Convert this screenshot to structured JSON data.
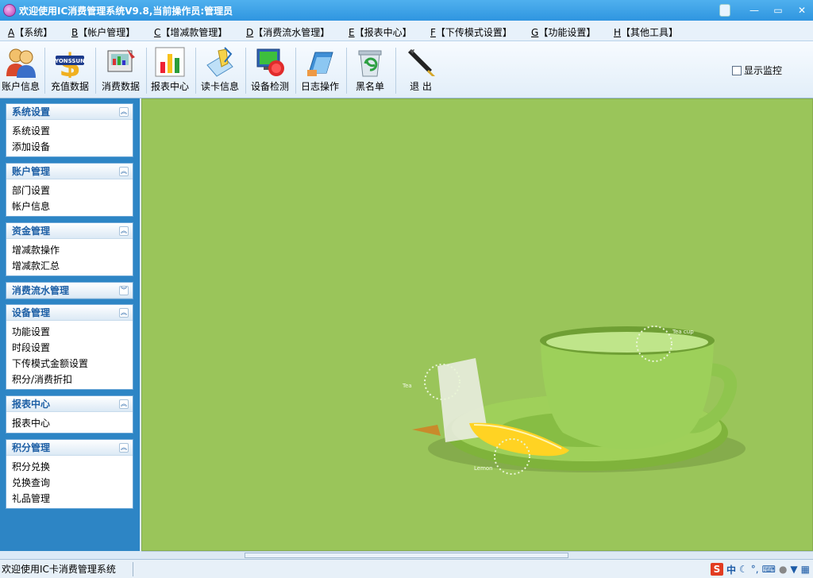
{
  "window": {
    "title": "欢迎使用IC消费管理系统V9.8,当前操作员:管理员",
    "controls": {
      "minimize": "—",
      "maximize": "▭",
      "close": "✕"
    }
  },
  "menu": [
    {
      "key": "A",
      "label": "【系统】"
    },
    {
      "key": "B",
      "label": "【帐户管理】"
    },
    {
      "key": "C",
      "label": "【增减款管理】"
    },
    {
      "key": "D",
      "label": "【消费流水管理】"
    },
    {
      "key": "E",
      "label": "【报表中心】"
    },
    {
      "key": "F",
      "label": "【下传模式设置】"
    },
    {
      "key": "G",
      "label": "【功能设置】"
    },
    {
      "key": "H",
      "label": "【其他工具】"
    }
  ],
  "toolbar": {
    "items": [
      {
        "label": "账户信息",
        "icon": "users-icon"
      },
      {
        "label": "充值数据",
        "icon": "recharge-icon"
      },
      {
        "label": "消费数据",
        "icon": "consumption-icon"
      },
      {
        "label": "报表中心",
        "icon": "report-chart-icon"
      },
      {
        "label": "读卡信息",
        "icon": "card-read-icon"
      },
      {
        "label": "设备检测",
        "icon": "device-check-icon"
      },
      {
        "label": "日志操作",
        "icon": "log-icon"
      },
      {
        "label": "黑名单",
        "icon": "blacklist-icon"
      },
      {
        "label": "退 出",
        "icon": "exit-pen-icon"
      }
    ],
    "monitor_label": "显示监控",
    "monitor_checked": false
  },
  "sidebar": {
    "panels": [
      {
        "title": "系统设置",
        "expanded": true,
        "items": [
          "系统设置",
          "添加设备"
        ]
      },
      {
        "title": "账户管理",
        "expanded": true,
        "items": [
          "部门设置",
          "帐户信息"
        ]
      },
      {
        "title": "资金管理",
        "expanded": true,
        "items": [
          "增减款操作",
          "增减款汇总"
        ]
      },
      {
        "title": "消费流水管理",
        "expanded": false,
        "items": []
      },
      {
        "title": "设备管理",
        "expanded": true,
        "items": [
          "功能设置",
          "时段设置",
          "下传模式金额设置",
          "积分/消费折扣"
        ]
      },
      {
        "title": "报表中心",
        "expanded": true,
        "items": [
          "报表中心"
        ]
      },
      {
        "title": "积分管理",
        "expanded": true,
        "items": [
          "积分兑换",
          "兑换查询",
          "礼品管理"
        ]
      }
    ]
  },
  "wallpaper": {
    "labels": {
      "cup": "Tea cup",
      "bag": "Tea",
      "lemon": "Lemon"
    },
    "background": "#9ac55a"
  },
  "status": {
    "text": "欢迎使用IC卡消费管理系统",
    "ime_lang": "中"
  }
}
